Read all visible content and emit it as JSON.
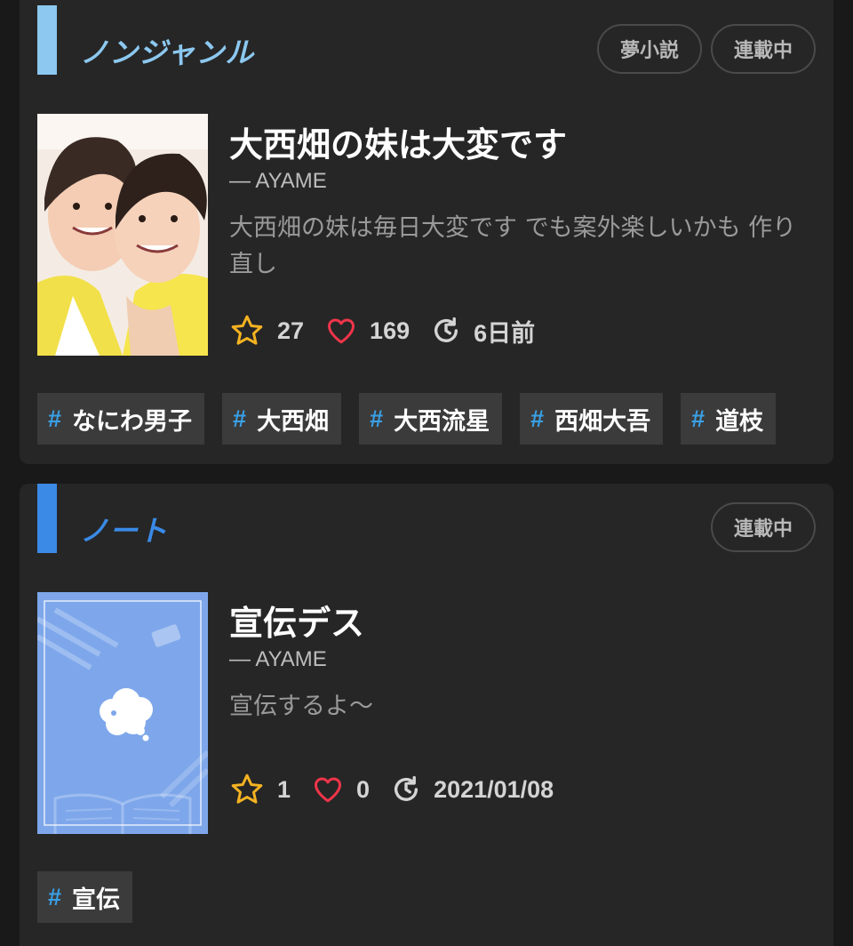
{
  "works": [
    {
      "category": "ノンジャンル",
      "category_color": "#8cc8f0",
      "badges": [
        "夢小説",
        "連載中"
      ],
      "title": "大西畑の妹は大変です",
      "author": "— AYAME",
      "description": "大西畑の妹は毎日大変です でも案外楽しいかも 作り直し",
      "stars": "27",
      "hearts": "169",
      "updated": "6日前",
      "tags": [
        "なにわ男子",
        "大西畑",
        "大西流星",
        "西畑大吾",
        "道枝"
      ]
    },
    {
      "category": "ノート",
      "category_color": "#3a8ae6",
      "badges": [
        "連載中"
      ],
      "title": "宣伝デス",
      "author": "— AYAME",
      "description": "宣伝するよ〜",
      "stars": "1",
      "hearts": "0",
      "updated": "2021/01/08",
      "tags": [
        "宣伝"
      ]
    }
  ],
  "colors": {
    "star": "#f5b322",
    "heart": "#f0354a",
    "hash": "#3aa0e6",
    "card_bg": "#262626",
    "page_bg": "#191919"
  }
}
